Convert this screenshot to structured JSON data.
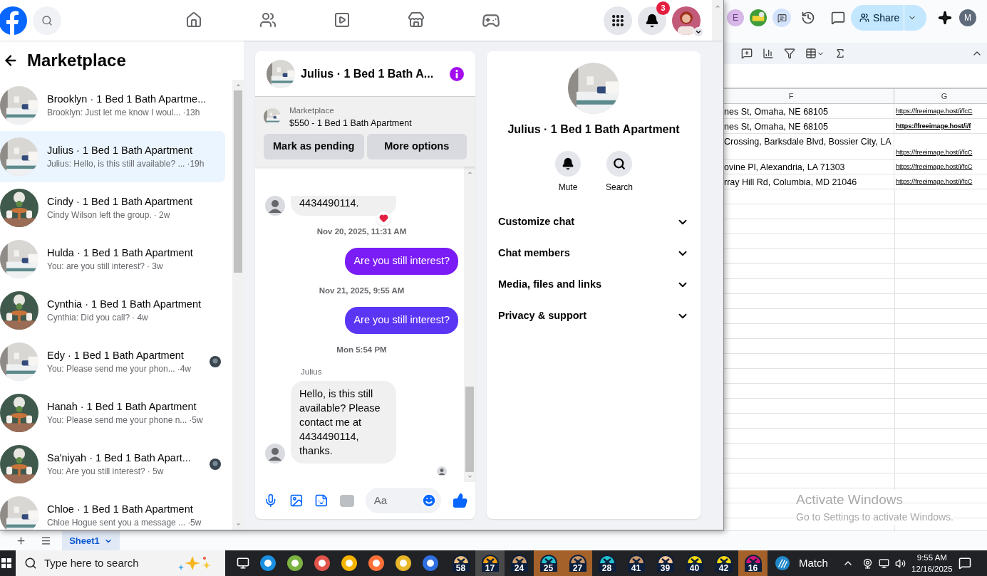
{
  "header": {
    "notification_count": "3"
  },
  "inbox": {
    "title": "Marketplace",
    "conversations": [
      {
        "title": "Brooklyn · 1 Bed 1 Bath Apartme...",
        "preview": "Brooklyn: Just let me know I woul...",
        "time": "·13h",
        "selected": false,
        "seen": false
      },
      {
        "title": "Julius · 1 Bed 1 Bath Apartment",
        "preview": "Julius: Hello, is this still available? ...",
        "time": "·19h",
        "selected": true,
        "seen": false
      },
      {
        "title": "Cindy · 1 Bed 1 Bath Apartment",
        "preview": "Cindy Wilson left the group.",
        "time": "· 2w",
        "selected": false,
        "seen": false
      },
      {
        "title": "Hulda · 1 Bed 1 Bath Apartment",
        "preview": "You: are you still interest?",
        "time": "· 3w",
        "selected": false,
        "seen": false
      },
      {
        "title": "Cynthia · 1 Bed 1 Bath Apartment",
        "preview": "Cynthia: Did you call?",
        "time": "· 4w",
        "selected": false,
        "seen": false
      },
      {
        "title": "Edy · 1 Bed 1 Bath Apartment",
        "preview": "You: Please send me your phon...",
        "time": "·4w",
        "selected": false,
        "seen": true
      },
      {
        "title": "Hanah · 1 Bed 1 Bath Apartment",
        "preview": "You: Please send me your phone n...",
        "time": "·5w",
        "selected": false,
        "seen": false
      },
      {
        "title": "Sa'niyah · 1 Bed 1 Bath Apart...",
        "preview": "You: Are you still interest?",
        "time": "· 5w",
        "selected": false,
        "seen": true
      },
      {
        "title": "Chloe · 1 Bed 1 Bath Apartment",
        "preview": "Chloe Hogue sent you a message ...",
        "time": "·5w",
        "selected": false,
        "seen": false
      }
    ]
  },
  "chat": {
    "title": "Julius · 1 Bed 1 Bath A...",
    "listing": {
      "label": "Marketplace",
      "title": "$550 - 1 Bed 1 Bath Apartment"
    },
    "actions": [
      "Mark as pending",
      "More options"
    ],
    "messages": [
      {
        "kind": "incoming",
        "text": "4434490114.",
        "reaction": true
      },
      {
        "kind": "timestamp",
        "text": "Nov 20, 2025, 11:31 AM"
      },
      {
        "kind": "outgoing",
        "text": "Are you still interest?",
        "color": "#7a1cf6"
      },
      {
        "kind": "timestamp",
        "text": "Nov 21, 2025, 9:55 AM"
      },
      {
        "kind": "outgoing",
        "text": "Are you still interest?",
        "color": "#5b35f4"
      },
      {
        "kind": "timestamp",
        "text": "Mon 5:54 PM"
      },
      {
        "kind": "incoming",
        "sender": "Julius",
        "text": "Hello, is this still available? Please contact me at 4434490114, thanks.",
        "reaction": false
      }
    ],
    "composer": {
      "placeholder": "Aa"
    }
  },
  "details": {
    "name": "Julius · 1 Bed 1 Bath Apartment",
    "actions": [
      {
        "kind": "mute",
        "label": "Mute"
      },
      {
        "kind": "search",
        "label": "Search"
      }
    ],
    "sections": [
      {
        "label": "Customize chat",
        "expanded": false
      },
      {
        "label": "Chat members",
        "expanded": false
      },
      {
        "label": "Media, files and links",
        "expanded": false
      },
      {
        "label": "Privacy & support",
        "expanded": false
      }
    ]
  },
  "spreadsheet": {
    "avatars": [
      "E",
      "M"
    ],
    "share_label": "Share",
    "columns": [
      "F",
      "G"
    ],
    "rows": [
      {
        "address": "nes St, Omaha, NE 68105",
        "link": "https://freeimage.host/i/fcC",
        "bold": false
      },
      {
        "address": "nes St, Omaha, NE 68105",
        "link": "https://freeimage.host/i/f",
        "bold": true
      },
      {
        "address": "Crossing, Barksdale Blvd, Bossier City, LA",
        "link": "https://freeimage.host/i/fcC",
        "bold": false
      },
      {
        "address": "ovine Pl, Alexandria, LA 71303",
        "link": "https://freeimage.host/i/fcC",
        "bold": false
      },
      {
        "address": "rray Hill Rd, Columbia, MD 21046",
        "link": "https://freeimage.host/i/fcC",
        "bold": false
      }
    ],
    "sheets": [
      {
        "label": "Sheet1",
        "selected": true
      }
    ]
  },
  "activation_notice": {
    "title": "Activate Windows",
    "subtitle": "Go to Settings to activate Windows."
  },
  "taskbar": {
    "search_placeholder": "Type here to search",
    "pinned": [
      {
        "label": "58",
        "color": "#f1c27d",
        "active": false,
        "flashing": false
      },
      {
        "label": "17",
        "color": "#f59e0b",
        "active": true,
        "flashing": false
      },
      {
        "label": "24",
        "color": "#d2a06b",
        "active": false,
        "flashing": false
      },
      {
        "label": "25",
        "color": "#22c4d0",
        "active": false,
        "flashing": true
      },
      {
        "label": "27",
        "color": "#c8956a",
        "active": false,
        "flashing": true
      },
      {
        "label": "28",
        "color": "#22c4d0",
        "active": false,
        "flashing": false
      },
      {
        "label": "41",
        "color": "#c8956a",
        "active": false,
        "flashing": false
      },
      {
        "label": "39",
        "color": "#f6c79a",
        "active": false,
        "flashing": false
      },
      {
        "label": "40",
        "color": "#f5d90a",
        "active": false,
        "flashing": false
      },
      {
        "label": "42",
        "color": "#f5d90a",
        "active": false,
        "flashing": false
      },
      {
        "label": "16",
        "color": "#d1127a",
        "active": false,
        "flashing": true
      }
    ],
    "weather": "Match",
    "time": "9:55 AM",
    "date": "12/16/2025"
  }
}
